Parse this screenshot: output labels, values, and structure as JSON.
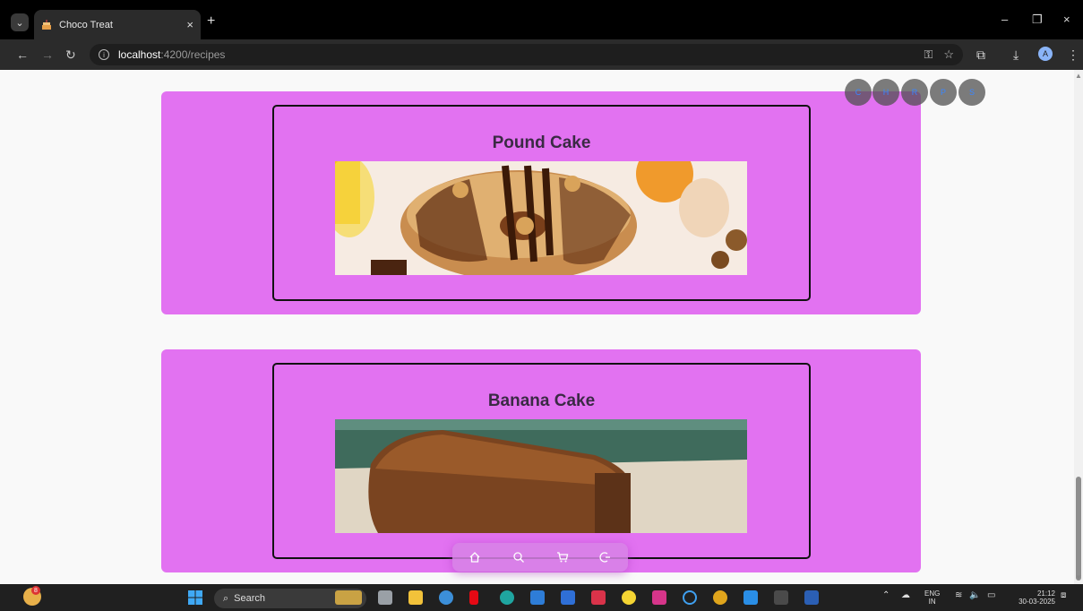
{
  "browser": {
    "tab_title": "Choco Treat",
    "tab_close": "×",
    "new_tab": "+",
    "url_host": "localhost",
    "url_path": ":4200/recipes",
    "profile_initial": "A",
    "window_min": "–",
    "window_restore": "❐",
    "window_close": "×"
  },
  "recipes": [
    {
      "title": "Pound Cake"
    },
    {
      "title": "Banana Cake"
    }
  ],
  "top_icons": [
    "C",
    "H",
    "R",
    "P",
    "S"
  ],
  "bottom_nav": [
    "home-icon",
    "search-icon",
    "cart-icon",
    "logout-icon"
  ],
  "taskbar": {
    "search_label": "Search",
    "lang_top": "ENG",
    "lang_bottom": "IN",
    "time": "21:12",
    "date": "30-03-2025",
    "notification_count": "8"
  },
  "colors": {
    "card": "#e272f1",
    "page_bg": "#f9f9f9",
    "browser_dark": "#2b2b2b"
  }
}
